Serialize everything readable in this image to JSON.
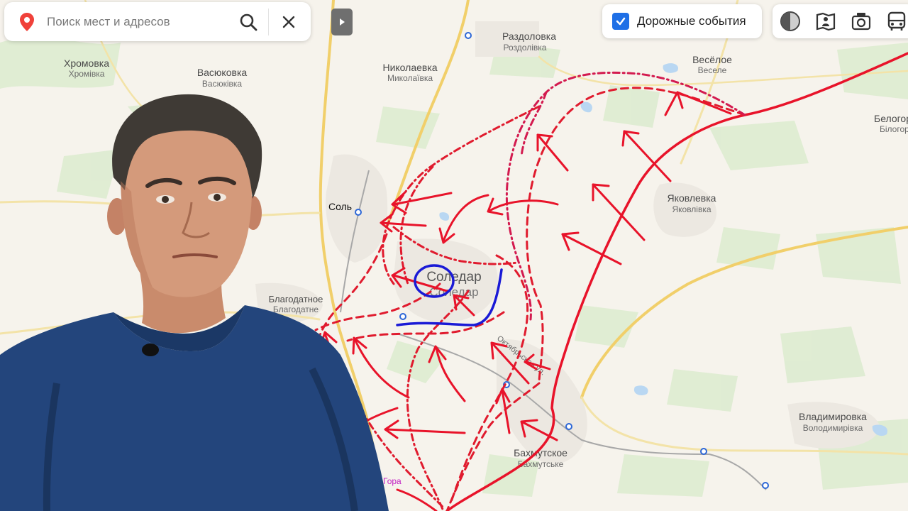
{
  "search": {
    "placeholder": "Поиск мест и адресов"
  },
  "traffic": {
    "label": "Дорожные события",
    "checked": true
  },
  "layers": [
    "map-mode-icon",
    "panorama-icon",
    "camera-icon",
    "transit-icon"
  ],
  "colors": {
    "attack_red": "#e8132a",
    "dashed_red": "#e01b2e",
    "dotted_magenta": "#d31a4f",
    "defense_blue": "#1a1ad6",
    "road_yellow": "#f1cf6a",
    "river_blue": "#a9cdef"
  },
  "places": [
    {
      "ru": "Хромовка",
      "uk": "Хромівка"
    },
    {
      "ru": "Васюковка",
      "uk": "Васюківка"
    },
    {
      "ru": "Николаевка",
      "uk": "Миколаївка"
    },
    {
      "ru": "Раздоловка",
      "uk": "Роздолівка"
    },
    {
      "ru": "Весёлое",
      "uk": "Веселе"
    },
    {
      "ru": "Белогор",
      "uk": "Білогор"
    },
    {
      "ru": "Соль",
      "uk": ""
    },
    {
      "ru": "Яковлевка",
      "uk": "Яковлівка"
    },
    {
      "ru": "Соледар",
      "uk": "Соледар"
    },
    {
      "ru": "Благодатное",
      "uk": "Благодатне"
    },
    {
      "ru": "Владимировка",
      "uk": "Володимирівка"
    },
    {
      "ru": "Бахмутское",
      "uk": "Бахмутське"
    },
    {
      "ru": "Гора",
      "uk": ""
    }
  ],
  "street": "Октябрьская ул."
}
